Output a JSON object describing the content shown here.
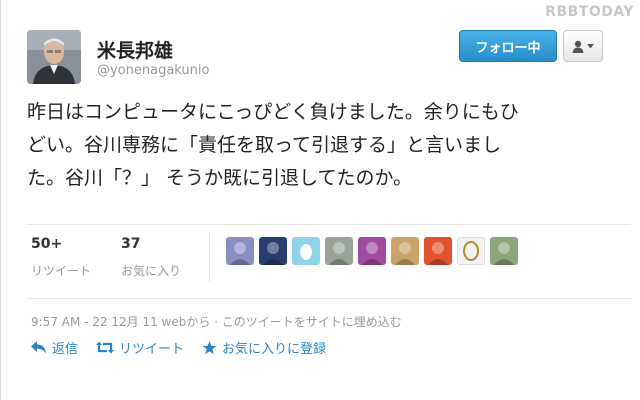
{
  "watermark": "RBBTODAY",
  "profile": {
    "name": "米長邦雄",
    "handle": "@yonenagakunio",
    "avatar_icon": "person-photo"
  },
  "follow_button": {
    "label": "フォロー中",
    "color": "#2a8fcb"
  },
  "user_menu": {
    "icon": "user-icon",
    "caret": "chevron-down-icon"
  },
  "tweet": {
    "lines": [
      "昨日はコンピュータにこっぴどく負けました。余りにもひ",
      "どい。谷川専務に「責任を取って引退する」と言いまし",
      "た。谷川「？」 そうか既に引退してたのか。"
    ]
  },
  "stats": {
    "retweets": {
      "count": "50+",
      "label": "リツイート"
    },
    "favorites": {
      "count": "37",
      "label": "お気に入り"
    }
  },
  "favoriters": [
    {
      "icon": "avatar-thumb-1",
      "color": "#8a8fc4"
    },
    {
      "icon": "avatar-thumb-2",
      "color": "#2a3d6e"
    },
    {
      "icon": "avatar-thumb-egg",
      "color": "#8fd3e8"
    },
    {
      "icon": "avatar-thumb-4",
      "color": "#9aa39a"
    },
    {
      "icon": "avatar-thumb-5",
      "color": "#a24aa0"
    },
    {
      "icon": "avatar-thumb-6",
      "color": "#c9a46a"
    },
    {
      "icon": "avatar-thumb-7",
      "color": "#e2522c"
    },
    {
      "icon": "avatar-thumb-8",
      "color": "#f2f2f2"
    },
    {
      "icon": "avatar-thumb-9",
      "color": "#8da57a"
    }
  ],
  "meta": {
    "timestamp": "9:57 AM - 22 12月 11 webから · このツイートをサイトに埋め込む"
  },
  "actions": {
    "reply": "返信",
    "retweet": "リツイート",
    "favorite": "お気に入りに登録",
    "color": "#2a85c6"
  }
}
